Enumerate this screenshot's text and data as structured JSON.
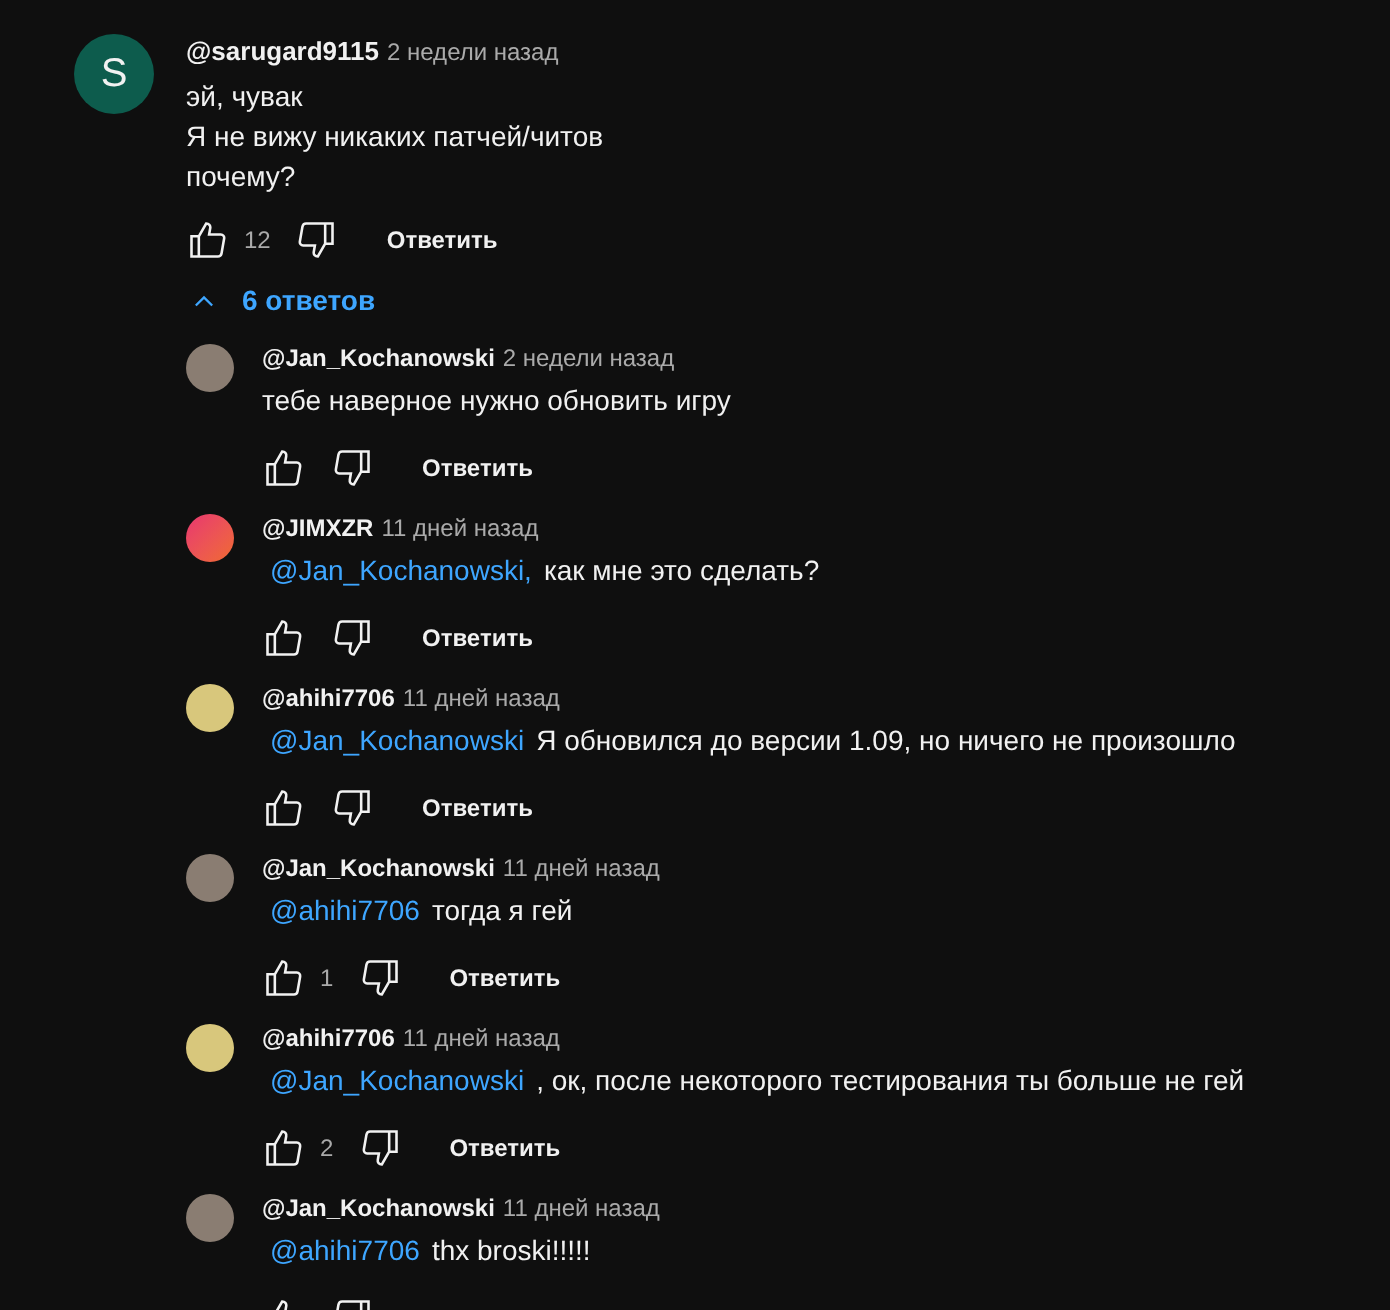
{
  "comment": {
    "avatar_letter": "S",
    "author": "@sarugard9115",
    "time": "2 недели назад",
    "lines": [
      "эй, чувак",
      "Я не вижу никаких патчей/читов",
      "почему?"
    ],
    "likes": "12",
    "reply_label": "Ответить"
  },
  "replies_toggle": {
    "label": "6 ответов",
    "expanded": true
  },
  "replies": [
    {
      "avatar": {
        "kind": "photo"
      },
      "author": "@Jan_Kochanowski",
      "time": "2 недели назад",
      "text": "тебе наверное нужно обновить игру",
      "reply_label": "Ответить"
    },
    {
      "avatar": {
        "kind": "logo"
      },
      "author": "@JIMXZR",
      "time": "11 дней назад",
      "mention": "@Jan_Kochanowski,",
      "text": "как мне это сделать?",
      "reply_label": "Ответить"
    },
    {
      "avatar": {
        "kind": "plain",
        "color": "#d8c77c"
      },
      "author": "@ahihi7706",
      "time": "11 дней назад",
      "mention": "@Jan_Kochanowski",
      "text": "Я обновился до версии 1.09, но ничего не произошло",
      "reply_label": "Ответить"
    },
    {
      "avatar": {
        "kind": "photo"
      },
      "author": "@Jan_Kochanowski",
      "time": "11 дней назад",
      "mention": "@ahihi7706",
      "text": "тогда я гей",
      "likes": "1",
      "reply_label": "Ответить"
    },
    {
      "avatar": {
        "kind": "plain",
        "color": "#d8c77c"
      },
      "author": "@ahihi7706",
      "time": "11 дней назад",
      "mention": "@Jan_Kochanowski",
      "text": ", ок, после некоторого тестирования ты больше не гей",
      "likes": "2",
      "reply_label": "Ответить"
    },
    {
      "avatar": {
        "kind": "photo"
      },
      "author": "@Jan_Kochanowski",
      "time": "11 дней назад",
      "mention": "@ahihi7706",
      "text": "thx broski!!!!!"
    }
  ]
}
